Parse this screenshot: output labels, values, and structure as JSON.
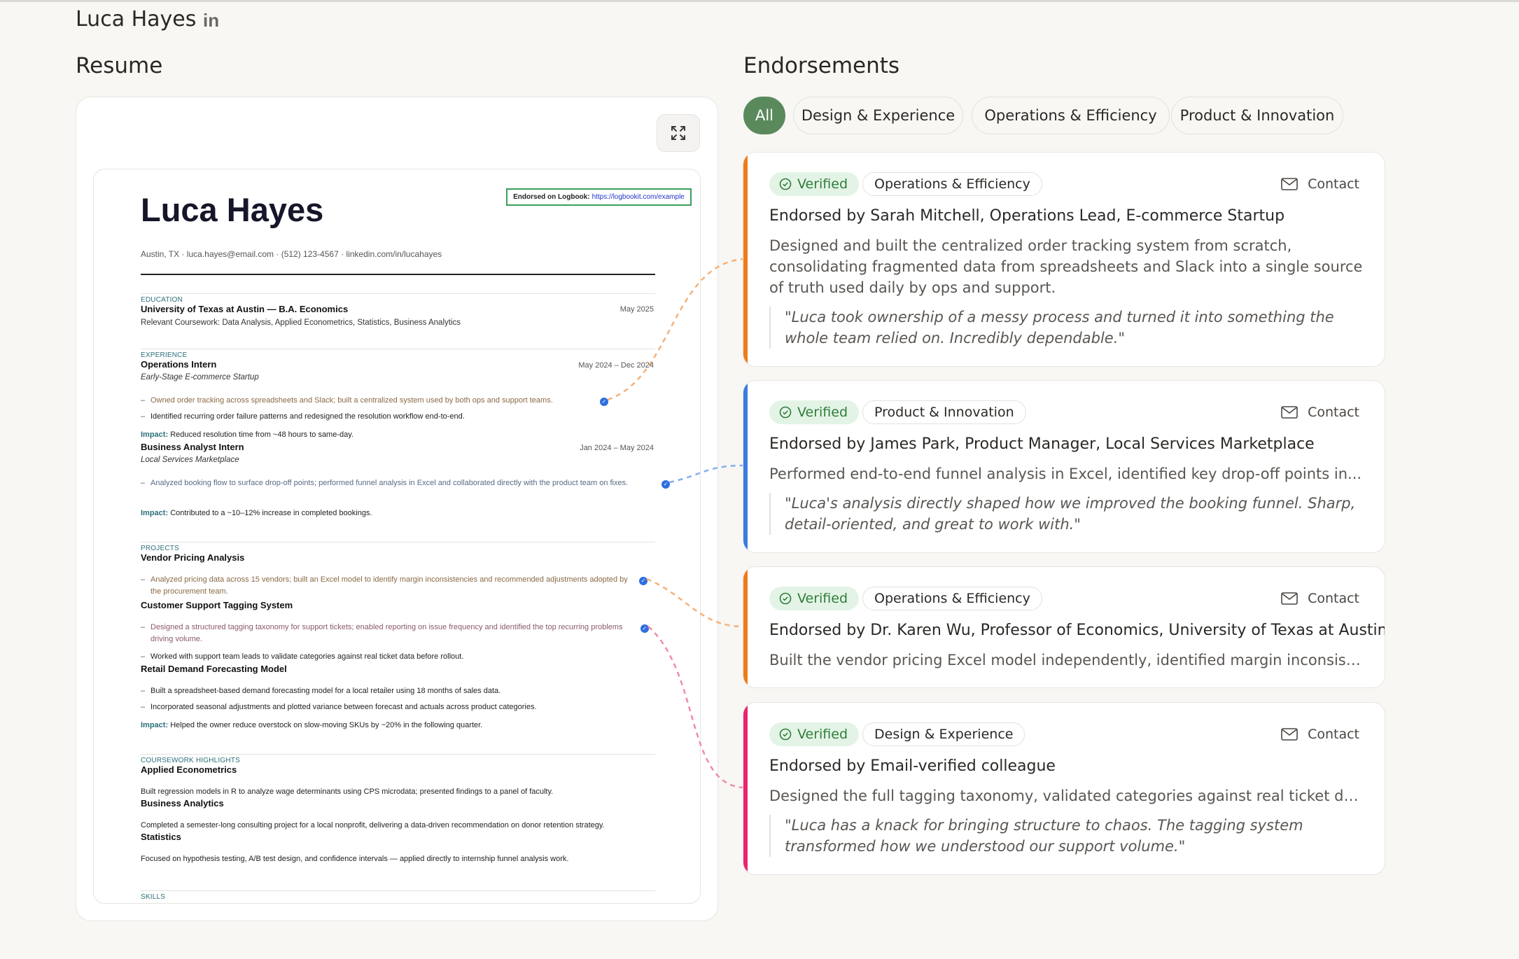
{
  "profile": {
    "name": "Luca Hayes",
    "linkedin_icon": "linkedin-icon"
  },
  "sections": {
    "resume": "Resume",
    "endorsements": "Endorsements"
  },
  "resume_doc": {
    "name": "Luca Hayes",
    "stamp_label": "Endorsed on Logbook:",
    "stamp_url": "https://logbookit.com/example",
    "contact": "Austin, TX   ·   luca.hayes@email.com   ·   (512) 123-4567   ·   linkedin.com/in/lucahayes",
    "education": {
      "label": "EDUCATION",
      "school": "University of Texas at Austin — B.A. Economics",
      "date": "May 2025",
      "coursework": "Relevant Coursework: Data Analysis, Applied Econometrics, Statistics, Business Analytics"
    },
    "experience": {
      "label": "EXPERIENCE",
      "jobs": [
        {
          "title": "Operations Intern",
          "date": "May 2024 – Dec 2024",
          "company": "Early-Stage E-commerce Startup",
          "bullets": [
            "Owned order tracking across spreadsheets and Slack; built a centralized system used by both ops and support teams.",
            "Identified recurring order failure patterns and redesigned the resolution workflow end-to-end."
          ],
          "impact_label": "Impact:",
          "impact": "Reduced resolution time from ~48 hours to same-day."
        },
        {
          "title": "Business Analyst Intern",
          "date": "Jan 2024 – May 2024",
          "company": "Local Services Marketplace",
          "bullets": [
            "Analyzed booking flow to surface drop-off points; performed funnel analysis in Excel and collaborated directly with the product team on fixes."
          ],
          "impact_label": "Impact:",
          "impact": "Contributed to a ~10–12% increase in completed bookings."
        }
      ]
    },
    "projects": {
      "label": "PROJECTS",
      "items": [
        {
          "title": "Vendor Pricing Analysis",
          "bullets": [
            "Analyzed pricing data across 15 vendors; built an Excel model to identify margin inconsistencies and recommended adjustments adopted by the procurement team."
          ]
        },
        {
          "title": "Customer Support Tagging System",
          "bullets": [
            "Designed a structured tagging taxonomy for support tickets; enabled reporting on issue frequency and identified the top recurring problems driving volume.",
            "Worked with support team leads to validate categories against real ticket data before rollout."
          ]
        },
        {
          "title": "Retail Demand Forecasting Model",
          "bullets": [
            "Built a spreadsheet-based demand forecasting model for a local retailer using 18 months of sales data.",
            "Incorporated seasonal adjustments and plotted variance between forecast and actuals across product categories."
          ],
          "impact_label": "Impact:",
          "impact": "Helped the owner reduce overstock on slow-moving SKUs by ~20% in the following quarter."
        }
      ]
    },
    "coursework": {
      "label": "COURSEWORK HIGHLIGHTS",
      "items": [
        {
          "title": "Applied Econometrics",
          "text": "Built regression models in R to analyze wage determinants using CPS microdata; presented findings to a panel of faculty."
        },
        {
          "title": "Business Analytics",
          "text": "Completed a semester-long consulting project for a local nonprofit, delivering a data-driven recommendation on donor retention strategy."
        },
        {
          "title": "Statistics",
          "text": "Focused on hypothesis testing, A/B test design, and confidence intervals — applied directly to internship funnel analysis work."
        }
      ]
    },
    "skills_label": "SKILLS"
  },
  "filters": {
    "tabs": [
      "All",
      "Design & Experience",
      "Operations & Efficiency",
      "Product & Innovation"
    ],
    "active": "All"
  },
  "colors": {
    "accent_green": "#5a8a5c",
    "orange": "#f07a1a",
    "blue": "#3a7be0",
    "pink": "#e8256e",
    "verified_bg": "#e3f4e6",
    "verified_text": "#2f7d3a"
  },
  "endorsements": [
    {
      "verified_label": "Verified",
      "category": "Operations & Efficiency",
      "contact_label": "Contact",
      "endorser": "Endorsed by Sarah Mitchell, Operations Lead, E-commerce Startup",
      "summary": "Designed and built the centralized order tracking system from scratch, consolidating fragmented data from spreadsheets and Slack into a single source of truth used daily by ops and support.",
      "quote": "\"Luca took ownership of a messy process and turned it into something the whole team relied on. Incredibly dependable.\""
    },
    {
      "verified_label": "Verified",
      "category": "Product & Innovation",
      "contact_label": "Contact",
      "endorser": "Endorsed by James Park, Product Manager, Local Services Marketplace",
      "summary": "Performed end-to-end funnel analysis in Excel, identified key drop-off points in...",
      "quote": "\"Luca's analysis directly shaped how we improved the booking funnel. Sharp, detail-oriented, and great to work with.\""
    },
    {
      "verified_label": "Verified",
      "category": "Operations & Efficiency",
      "contact_label": "Contact",
      "endorser": "Endorsed by Dr. Karen Wu, Professor of Economics, University of Texas at Austin",
      "summary": "Built the vendor pricing Excel model independently, identified margin inconsiste..."
    },
    {
      "verified_label": "Verified",
      "category": "Design & Experience",
      "contact_label": "Contact",
      "endorser": "Endorsed by Email-verified colleague",
      "summary": "Designed the full tagging taxonomy, validated categories against real ticket dat...",
      "quote": "\"Luca has a knack for bringing structure to chaos. The tagging system transformed how we understood our support volume.\""
    }
  ]
}
